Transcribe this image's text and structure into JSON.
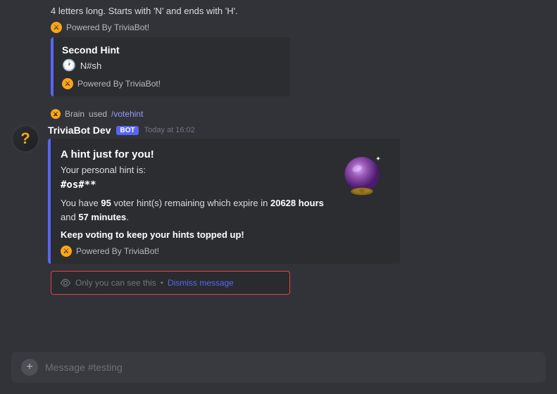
{
  "topMessage": {
    "text": "4 letters long. Starts with 'N' and ends with 'H'.",
    "footer": "Powered By TriviaBot!"
  },
  "secondHint": {
    "title": "Second Hint",
    "hint": "N#sh",
    "footer": "Powered By TriviaBot!"
  },
  "commandLine": {
    "user": "Brain",
    "action": "used",
    "command": "/votehint"
  },
  "bot": {
    "name": "TriviaBot Dev",
    "badge": "BOT",
    "timestamp": "Today at 16:02"
  },
  "hintEmbed": {
    "title": "A hint just for you!",
    "subtitle": "Your personal hint is:",
    "code": "#os#**",
    "body1": "You have ",
    "count": "95",
    "body2": " voter hint(s) remaining which expire in ",
    "hours": "20628 hours",
    "body3": " and ",
    "minutes": "57 minutes",
    "body4": ".",
    "cta": "Keep voting to keep your hints topped up!",
    "footer": "Powered By TriviaBot!"
  },
  "dismissMessage": {
    "text": "Only you can see this",
    "separator": "•",
    "linkText": "Dismiss message"
  },
  "inputBar": {
    "placeholder": "Message #testing"
  }
}
